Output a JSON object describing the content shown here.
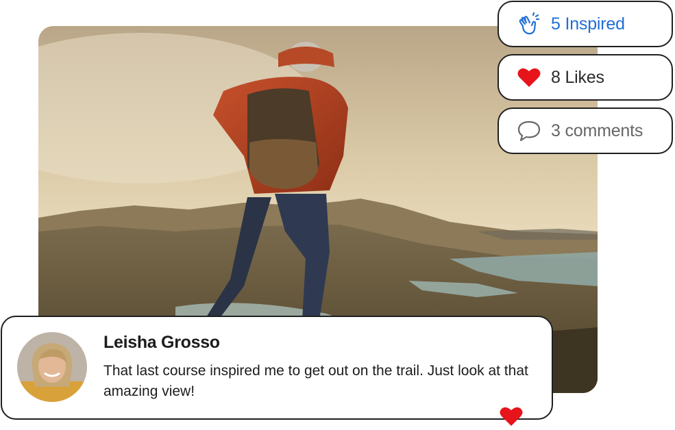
{
  "reactions": {
    "inspired": {
      "label": "5 Inspired",
      "icon": "clapping-hands-icon",
      "color": "#1f6fd6"
    },
    "likes": {
      "label": "8 Likes",
      "icon": "heart-icon",
      "color": "#e8141c"
    },
    "comments": {
      "label": "3 comments",
      "icon": "speech-bubble-icon",
      "color": "#666666"
    }
  },
  "comment": {
    "author": "Leisha Grosso",
    "text": "That last course inspired me to get out on the trail. Just look at that amazing view!",
    "reaction_icon": "heart-icon"
  }
}
